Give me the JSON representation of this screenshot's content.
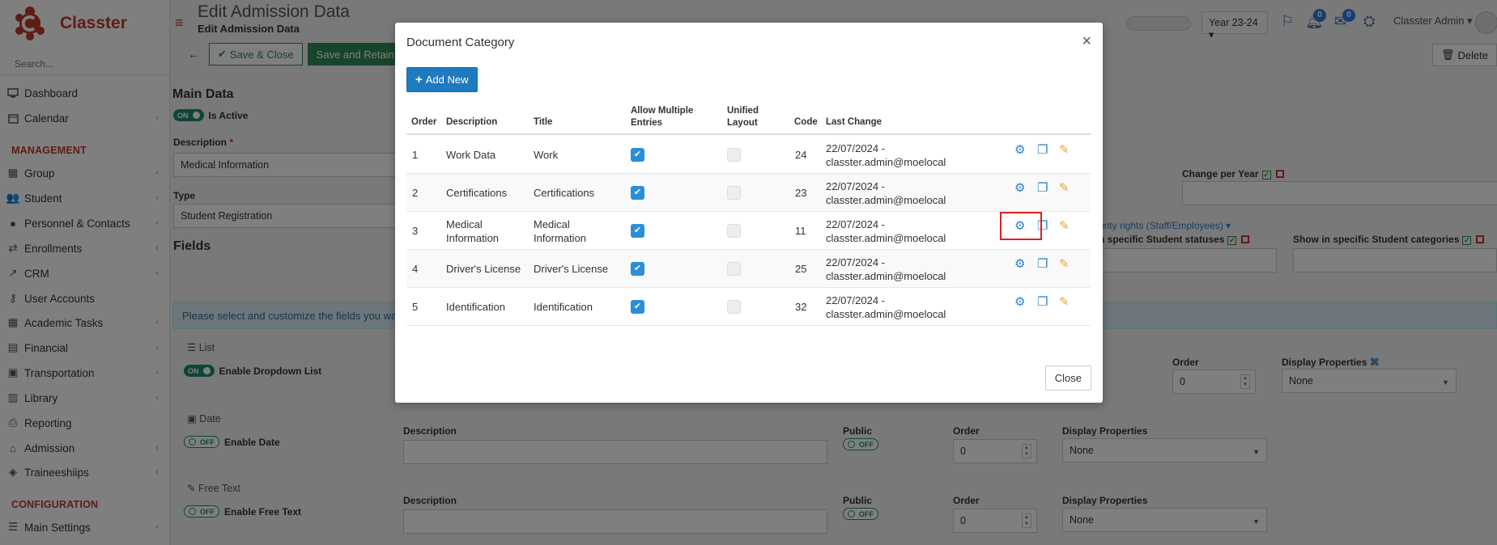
{
  "app": {
    "name": "Classter"
  },
  "sidebar": {
    "search_placeholder": "Search...",
    "items": [
      {
        "label": "Dashboard",
        "icon": "monitor-icon",
        "chev": false
      },
      {
        "label": "Calendar",
        "icon": "calendar-icon",
        "chev": true
      }
    ],
    "section_management": "MANAGEMENT",
    "mgmt_items": [
      {
        "label": "Group",
        "icon": "group-icon"
      },
      {
        "label": "Student",
        "icon": "student-icon"
      },
      {
        "label": "Personnel & Contacts",
        "icon": "personnel-icon"
      },
      {
        "label": "Enrollments",
        "icon": "enrollments-icon"
      },
      {
        "label": "CRM",
        "icon": "crm-icon"
      },
      {
        "label": "User Accounts",
        "icon": "key-icon"
      },
      {
        "label": "Academic Tasks",
        "icon": "grid-icon"
      },
      {
        "label": "Financial",
        "icon": "financial-icon"
      },
      {
        "label": "Transportation",
        "icon": "bus-icon"
      },
      {
        "label": "Library",
        "icon": "library-icon"
      },
      {
        "label": "Reporting",
        "icon": "printer-icon"
      },
      {
        "label": "Admission",
        "icon": "admission-icon"
      },
      {
        "label": "Traineeshiips",
        "icon": "traineeship-icon"
      }
    ],
    "section_configuration": "CONFIGURATION",
    "config_items": [
      {
        "label": "Main Settings",
        "icon": "sliders-icon"
      }
    ]
  },
  "header": {
    "title": "Edit Admission Data",
    "subtitle": "Edit Admission Data",
    "year": "Year 23-24",
    "notif_count": "0",
    "mail_count": "0",
    "user": "Classter Admin"
  },
  "toolbar": {
    "save_close": "Save & Close",
    "save_retain": "Save and Retain",
    "delete": "Delete"
  },
  "form": {
    "main_data": "Main Data",
    "toggle_on": "ON",
    "toggle_off": "OFF",
    "is_active": "Is Active",
    "description_label": "Description",
    "description_value": "Medical Information",
    "type_label": "Type",
    "type_value": "Student Registration",
    "change_per_year": "Change per Year",
    "security_rights": "urity rights (Staff/Employees)",
    "student_statuses": "n specific Student statuses",
    "student_categories": "Show in specific Student categories",
    "fields_heading": "Fields",
    "info_text": "Please select and customize the fields you wan",
    "list_label": "List",
    "enable_dropdown": "Enable Dropdown List",
    "date_label": "Date",
    "enable_date": "Enable Date",
    "free_text_label": "Free Text",
    "enable_free_text": "Enable Free Text",
    "col_description": "Description",
    "col_public": "Public",
    "col_order": "Order",
    "col_display_props": "Display Properties",
    "order_value": "0",
    "display_none": "None"
  },
  "modal": {
    "title": "Document Category",
    "add_new": "Add New",
    "close": "Close",
    "columns": {
      "order": "Order",
      "description": "Description",
      "title": "Title",
      "allow_multiple_1": "Allow Multiple",
      "allow_multiple_2": "Entries",
      "unified_1": "Unified",
      "unified_2": "Layout",
      "code": "Code",
      "last_change": "Last Change"
    },
    "rows": [
      {
        "order": "1",
        "desc1": "Work Data",
        "desc2": "",
        "title1": "Work",
        "title2": "",
        "allow": true,
        "unified": false,
        "code": "24",
        "lc1": "22/07/2024 -",
        "lc2": "classter.admin@moelocal"
      },
      {
        "order": "2",
        "desc1": "Certifications",
        "desc2": "",
        "title1": "Certifications",
        "title2": "",
        "allow": true,
        "unified": false,
        "code": "23",
        "lc1": "22/07/2024 -",
        "lc2": "classter.admin@moelocal"
      },
      {
        "order": "3",
        "desc1": "Medical",
        "desc2": "Information",
        "title1": "Medical",
        "title2": "Information",
        "allow": true,
        "unified": false,
        "code": "11",
        "lc1": "22/07/2024 -",
        "lc2": "classter.admin@moelocal"
      },
      {
        "order": "4",
        "desc1": "Driver's License",
        "desc2": "",
        "title1": "Driver's License",
        "title2": "",
        "allow": true,
        "unified": false,
        "code": "25",
        "lc1": "22/07/2024 -",
        "lc2": "classter.admin@moelocal"
      },
      {
        "order": "5",
        "desc1": "Identification",
        "desc2": "",
        "title1": "Identification",
        "title2": "",
        "allow": true,
        "unified": false,
        "code": "32",
        "lc1": "22/07/2024 -",
        "lc2": "classter.admin@moelocal"
      }
    ]
  },
  "colors": {
    "brand_red": "#c0392b",
    "primary_blue": "#1f7bc0",
    "save_green": "#2e8b57",
    "highlight_red": "#e02020"
  }
}
